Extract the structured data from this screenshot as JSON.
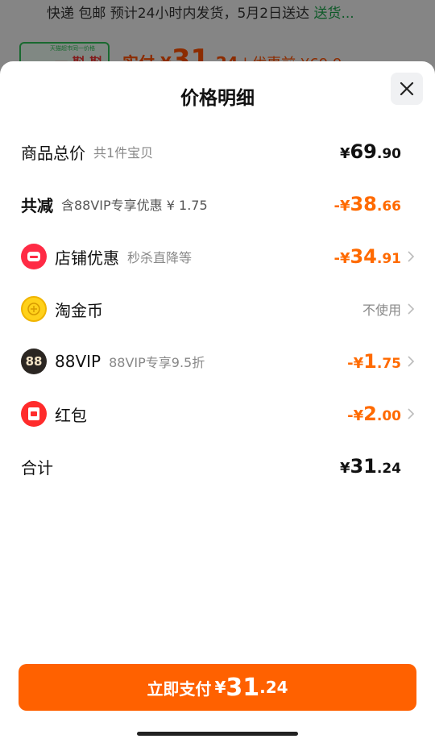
{
  "background": {
    "shipping_prefix": "快递 包邮 预计24小时内发货，5月2日送达 ",
    "shipping_link": "送货...",
    "thumb_mini": "天猫超市同一价格",
    "thumb_red": "一 斟 斟 一",
    "price_prefix": "实付 ¥",
    "price_int": "31",
    "price_dec": ".24",
    "price_sep": " | ",
    "price_original": "优惠前 ¥69.9"
  },
  "sheet": {
    "title": "价格明细",
    "close_icon": "close-icon"
  },
  "rows": {
    "total": {
      "label": "商品总价",
      "sub": "共1件宝贝",
      "cur": "¥",
      "int": "69",
      "dec": ".90"
    },
    "discount": {
      "label": "共减",
      "sub": "含88VIP专享优惠 ¥ 1.75",
      "cur": "-¥",
      "int": "38",
      "dec": ".66"
    },
    "store": {
      "label": "店铺优惠",
      "sub": "秒杀直降等",
      "cur": "-¥",
      "int": "34",
      "dec": ".91",
      "icon": "store-icon"
    },
    "coin": {
      "label": "淘金币",
      "value": "不使用",
      "icon": "coin-icon"
    },
    "vip": {
      "label": "88VIP",
      "sub": "88VIP专享9.5折",
      "cur": "-¥",
      "int": "1",
      "dec": ".75",
      "icon": "vip-88-icon",
      "badge": "88"
    },
    "redpack": {
      "label": "红包",
      "cur": "-¥",
      "int": "2",
      "dec": ".00",
      "icon": "red-packet-icon"
    },
    "sum": {
      "label": "合计",
      "cur": "¥",
      "int": "31",
      "dec": ".24"
    }
  },
  "pay_button": {
    "label": "立即支付",
    "cur": "¥",
    "int": "31",
    "dec": ".24"
  },
  "colors": {
    "accent": "#ff6100",
    "discount": "#ff6a00",
    "store_icon": "#ff2b45",
    "coin_icon": "#ffd11a"
  }
}
